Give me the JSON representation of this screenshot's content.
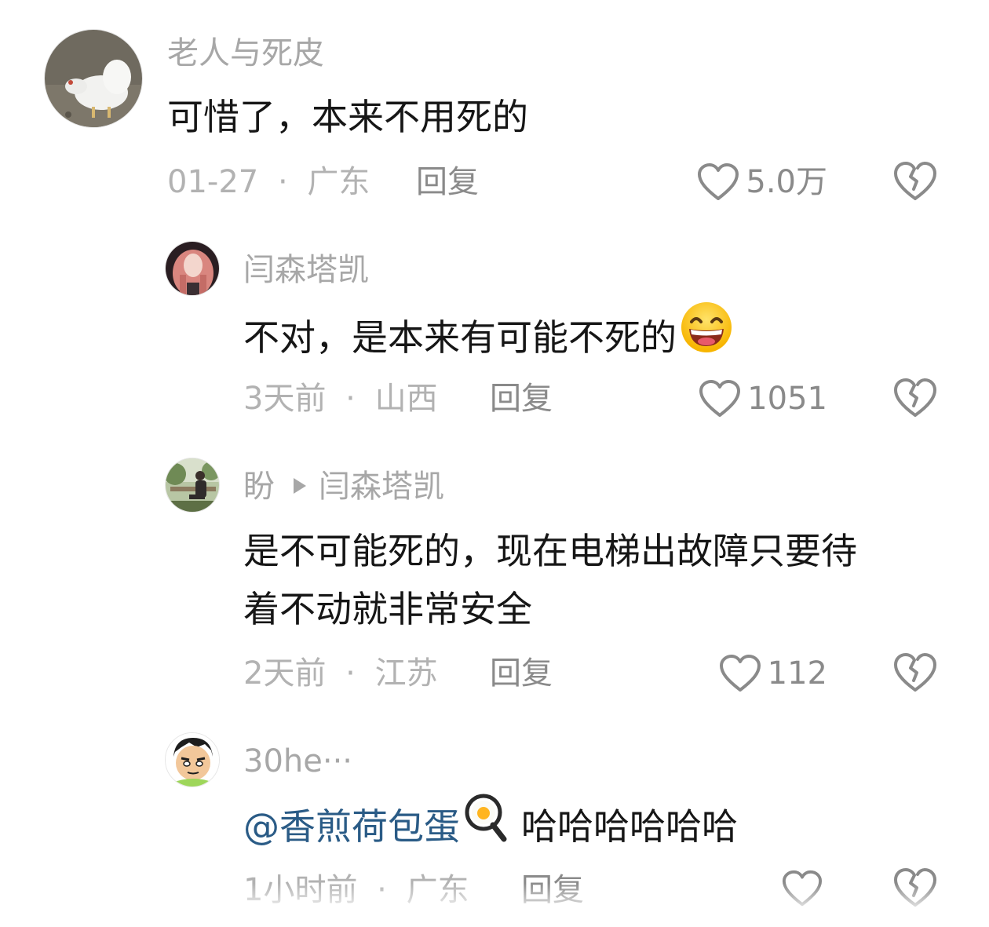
{
  "comments": [
    {
      "username": "老人与死皮",
      "avatar_icon": "white-chicken-avatar",
      "text": "可惜了，本来不用死的",
      "date": "01-27",
      "separator": "·",
      "location": "广东",
      "reply_label": "回复",
      "likes": "5.0万"
    },
    {
      "username": "闫森塔凯",
      "avatar_icon": "pink-hair-girl-avatar",
      "text": "不对，是本来有可能不死的",
      "emoji": "grinning-face-emoji",
      "date": "3天前",
      "separator": "·",
      "location": "山西",
      "reply_label": "回复",
      "likes": "1051"
    },
    {
      "username": "盼",
      "reply_to": "闫森塔凯",
      "avatar_icon": "person-sitting-forest-avatar",
      "text_line1": "是不可能死的，现在电梯出故障只要待",
      "text_line2": "着不动就非常安全",
      "date": "2天前",
      "separator": "·",
      "location": "江苏",
      "reply_label": "回复",
      "likes": "112"
    },
    {
      "username": "30he···",
      "avatar_icon": "cartoon-boy-avatar",
      "mention": "@香煎荷包蛋",
      "mention_emoji": "fried-egg-pan-emoji",
      "text": "哈哈哈哈哈哈",
      "date": "1小时前",
      "separator": "·",
      "location": "广东",
      "reply_label": "回复"
    }
  ],
  "colors": {
    "username": "#a7a7a7",
    "text": "#161616",
    "meta": "#b2b2b2",
    "action": "#8a8a8a",
    "mention": "#2a5b86"
  }
}
